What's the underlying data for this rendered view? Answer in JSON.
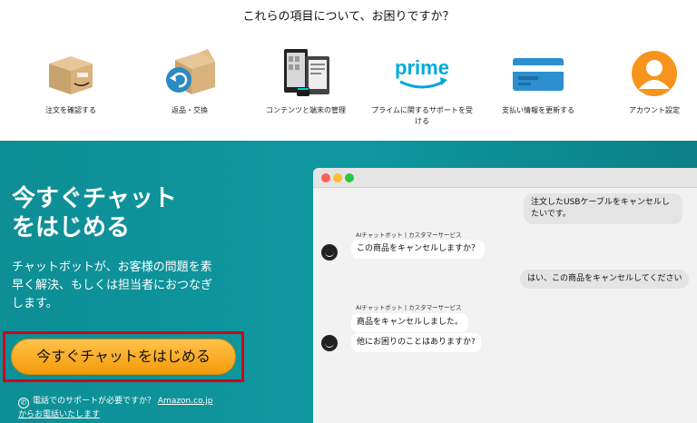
{
  "header": {
    "title": "これらの項目について、お困りですか？"
  },
  "categories": [
    {
      "label": "注文を確認する",
      "icon": "package-box-icon"
    },
    {
      "label": "返品・交換",
      "icon": "return-box-icon"
    },
    {
      "label": "コンテンツと端末の管理",
      "icon": "devices-icon"
    },
    {
      "label": "プライムに関するサポートを受ける",
      "icon": "prime-logo-icon",
      "icon_text": "prime"
    },
    {
      "label": "支払い情報を更新する",
      "icon": "credit-card-icon"
    },
    {
      "label": "アカウント設定",
      "icon": "user-account-icon"
    }
  ],
  "hero": {
    "title_line1": "今すぐチャット",
    "title_line2": "をはじめる",
    "desc": "チャットボットが、お客様の問題を素早く解決、もしくは担当者におつなぎします。",
    "cta_label": "今すぐチャットをはじめる",
    "phone_text": "電話でのサポートが必要ですか？",
    "phone_link_line1": "Amazon.co.jp",
    "phone_link_line2": "からお電話いたします"
  },
  "chat": {
    "user_msg1": "注文したUSBケーブルをキャンセルしたいです。",
    "bot_label1": "AIチャットボット | カスタマーサービス",
    "bot_msg1": "この商品をキャンセルしますか？",
    "user_msg2": "はい、この商品をキャンセルしてください",
    "bot_label2": "AIチャットボット | カスタマーサービス",
    "bot_msg2": "商品をキャンセルしました。",
    "bot_msg3": "他にお困りのことはありますか?"
  },
  "colors": {
    "hero_teal": "#0f98a0",
    "cta_orange": "#f7a51f",
    "highlight_red": "#d0021b",
    "prime_blue": "#00a8e1",
    "account_orange": "#f7941d"
  }
}
